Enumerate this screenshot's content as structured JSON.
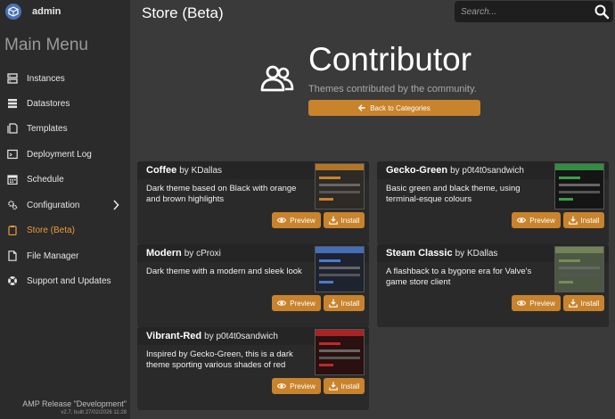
{
  "user": {
    "name": "admin"
  },
  "sidebar": {
    "title": "Main Menu",
    "items": [
      {
        "label": "Instances",
        "icon": "server-icon"
      },
      {
        "label": "Datastores",
        "icon": "database-icon"
      },
      {
        "label": "Templates",
        "icon": "template-icon"
      },
      {
        "label": "Deployment Log",
        "icon": "terminal-icon"
      },
      {
        "label": "Schedule",
        "icon": "calendar-icon"
      },
      {
        "label": "Configuration",
        "icon": "gears-icon"
      },
      {
        "label": "Store (Beta)",
        "icon": "clipboard-icon",
        "active": true
      },
      {
        "label": "File Manager",
        "icon": "file-icon"
      },
      {
        "label": "Support and Updates",
        "icon": "lifebuoy-icon"
      }
    ],
    "footer": {
      "title": "AMP Release \"Development\"",
      "version": "v2.7, built 27/02/2026 11:28"
    }
  },
  "header": {
    "title": "Store (Beta)"
  },
  "search": {
    "placeholder": "Search..."
  },
  "hero": {
    "title": "Contributor",
    "subtitle": "Themes contributed by the community.",
    "back_label": "Back to Categories"
  },
  "buttons": {
    "preview": "Preview",
    "install": "Install"
  },
  "cards": [
    {
      "name": "Coffee",
      "author": "by KDallas",
      "desc": "Dark theme based on Black with orange and brown highlights",
      "accent": "#c8832c",
      "bg": "#2e2a26"
    },
    {
      "name": "Gecko-Green",
      "author": "by p0t4t0sandwich",
      "desc": "Basic green and black theme, using terminal-esque colours",
      "accent": "#3aa04a",
      "bg": "#151515"
    },
    {
      "name": "Modern",
      "author": "by cProxi",
      "desc": "Dark theme with a modern and sleek look",
      "accent": "#4a7bd0",
      "bg": "#1e2330"
    },
    {
      "name": "Steam Classic",
      "author": "by KDallas",
      "desc": "A flashback to a bygone era for Valve's game store client",
      "accent": "#7a8a5a",
      "bg": "#4c5844"
    },
    {
      "name": "Vibrant-Red",
      "author": "by p0t4t0sandwich",
      "desc": "Inspired by Gecko-Green, this is a dark theme sporting various shades of red",
      "accent": "#c02828",
      "bg": "#2a1010"
    }
  ],
  "colors": {
    "accent": "#c8832c",
    "sidebar": "#2b2b2b",
    "content": "#3a3a3a",
    "active": "#e89a3c"
  }
}
